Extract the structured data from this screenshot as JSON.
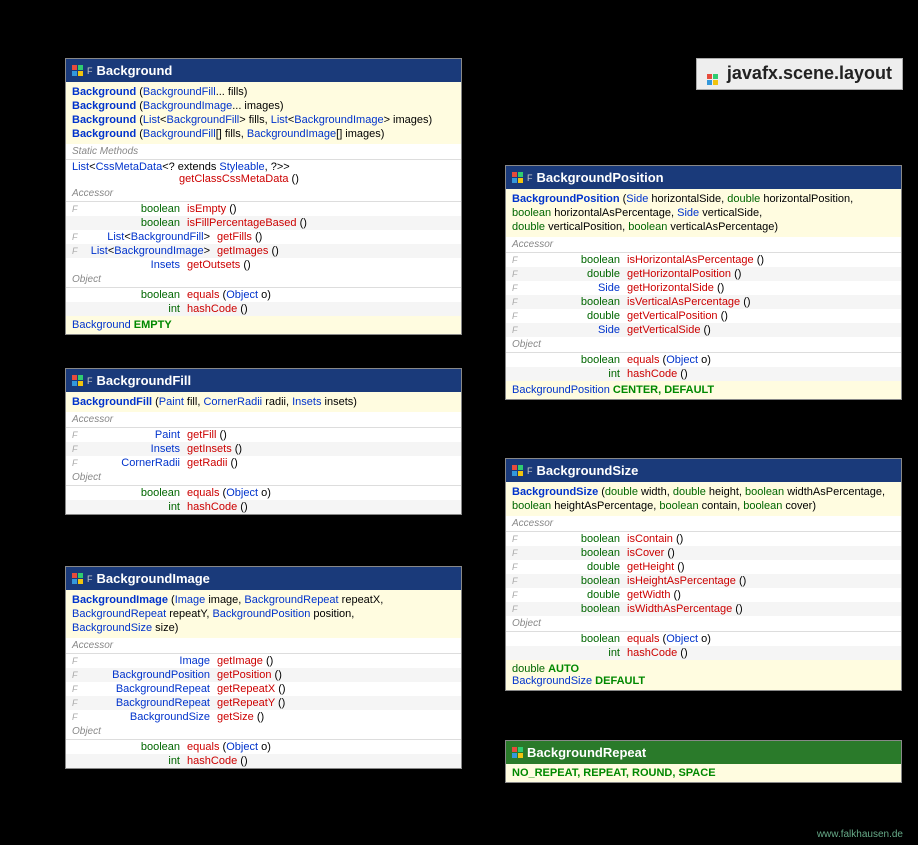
{
  "package": "javafx.scene.layout",
  "footer": "www.falkhausen.de",
  "classes": {
    "background": {
      "name": "Background",
      "final": true,
      "constructors": [
        [
          [
            "class",
            "Background"
          ],
          [
            " ("
          ],
          [
            "link",
            "BackgroundFill"
          ],
          [
            "",
            "... fills)"
          ]
        ],
        [
          [
            "class",
            "Background"
          ],
          [
            " ("
          ],
          [
            "link",
            "BackgroundImage"
          ],
          [
            "",
            "... images)"
          ]
        ],
        [
          [
            "class",
            "Background"
          ],
          [
            " ("
          ],
          [
            "link",
            "List"
          ],
          [
            "",
            "<"
          ],
          [
            "link",
            "BackgroundFill"
          ],
          [
            "",
            "> fills, "
          ],
          [
            "link",
            "List"
          ],
          [
            "",
            "<"
          ],
          [
            "link",
            "BackgroundImage"
          ],
          [
            "",
            "> images)"
          ]
        ],
        [
          [
            "class",
            "Background"
          ],
          [
            " ("
          ],
          [
            "link",
            "BackgroundFill"
          ],
          [
            "",
            "[] fills, "
          ],
          [
            "link",
            "BackgroundImage"
          ],
          [
            "",
            "[] images)"
          ]
        ]
      ],
      "static_label": "Static Methods",
      "static_methods": [
        {
          "ret": [
            [
              "link",
              "List"
            ],
            [
              "",
              "<"
            ],
            [
              "link",
              "CssMetaData"
            ],
            [
              "",
              "<? extends "
            ],
            [
              "link",
              "Styleable"
            ],
            [
              "",
              ", ?>>"
            ]
          ],
          "name": "getClassCssMetaData",
          "args": "()",
          "full": true
        }
      ],
      "accessor_label": "Accessor",
      "accessors": [
        {
          "f": true,
          "ret": [
            [
              "prim",
              "boolean"
            ]
          ],
          "name": "isEmpty",
          "args": "()"
        },
        {
          "f": false,
          "ret": [
            [
              "prim",
              "boolean"
            ]
          ],
          "name": "isFillPercentageBased",
          "args": "()"
        },
        {
          "f": true,
          "ret": [
            [
              "link",
              "List"
            ],
            [
              "",
              "<"
            ],
            [
              "link",
              "BackgroundFill"
            ],
            [
              "",
              ">"
            ]
          ],
          "name": "getFills",
          "args": "()",
          "wide": true
        },
        {
          "f": true,
          "ret": [
            [
              "link",
              "List"
            ],
            [
              "",
              "<"
            ],
            [
              "link",
              "BackgroundImage"
            ],
            [
              "",
              ">"
            ]
          ],
          "name": "getImages",
          "args": "()",
          "wide": true
        },
        {
          "f": false,
          "ret": [
            [
              "link",
              "Insets"
            ]
          ],
          "name": "getOutsets",
          "args": "()"
        }
      ],
      "object_label": "Object",
      "object_methods": [
        {
          "ret": [
            [
              "prim",
              "boolean"
            ]
          ],
          "name": "equals",
          "args": [
            [
              "",
              ""
            ],
            [
              "",
              " ("
            ],
            [
              "link",
              "Object"
            ],
            [
              "",
              " o)"
            ]
          ]
        },
        {
          "ret": [
            [
              "prim",
              "int"
            ]
          ],
          "name": "hashCode",
          "args": [
            [
              "",
              " ()"
            ]
          ]
        }
      ],
      "constants": [
        {
          "type": "Background",
          "vals": "EMPTY"
        }
      ]
    },
    "backgroundFill": {
      "name": "BackgroundFill",
      "final": true,
      "constructors": [
        [
          [
            "class",
            "BackgroundFill"
          ],
          [
            " ("
          ],
          [
            "link",
            "Paint"
          ],
          [
            "",
            " fill, "
          ],
          [
            "link",
            "CornerRadii"
          ],
          [
            "",
            " radii, "
          ],
          [
            "link",
            "Insets"
          ],
          [
            "",
            " insets)"
          ]
        ]
      ],
      "accessor_label": "Accessor",
      "accessors": [
        {
          "f": true,
          "ret": [
            [
              "link",
              "Paint"
            ]
          ],
          "name": "getFill",
          "args": "()"
        },
        {
          "f": true,
          "ret": [
            [
              "link",
              "Insets"
            ]
          ],
          "name": "getInsets",
          "args": "()"
        },
        {
          "f": true,
          "ret": [
            [
              "link",
              "CornerRadii"
            ]
          ],
          "name": "getRadii",
          "args": "()"
        }
      ],
      "object_label": "Object",
      "object_methods": [
        {
          "ret": [
            [
              "prim",
              "boolean"
            ]
          ],
          "name": "equals",
          "args": [
            [
              "",
              " ("
            ],
            [
              "link",
              "Object"
            ],
            [
              "",
              " o)"
            ]
          ]
        },
        {
          "ret": [
            [
              "prim",
              "int"
            ]
          ],
          "name": "hashCode",
          "args": [
            [
              "",
              " ()"
            ]
          ]
        }
      ]
    },
    "backgroundImage": {
      "name": "BackgroundImage",
      "final": true,
      "constructors": [
        [
          [
            "class",
            "BackgroundImage"
          ],
          [
            " ("
          ],
          [
            "link",
            "Image"
          ],
          [
            "",
            " image, "
          ],
          [
            "link",
            "BackgroundRepeat"
          ],
          [
            "",
            " repeatX,"
          ]
        ],
        [
          [
            "",
            "        "
          ],
          [
            "link",
            "BackgroundRepeat"
          ],
          [
            "",
            " repeatY, "
          ],
          [
            "link",
            "BackgroundPosition"
          ],
          [
            "",
            " position,"
          ]
        ],
        [
          [
            "",
            "        "
          ],
          [
            "link",
            "BackgroundSize"
          ],
          [
            "",
            " size)"
          ]
        ]
      ],
      "accessor_label": "Accessor",
      "accessors": [
        {
          "f": true,
          "ret": [
            [
              "link",
              "Image"
            ]
          ],
          "name": "getImage",
          "args": "()",
          "wide": true
        },
        {
          "f": true,
          "ret": [
            [
              "link",
              "BackgroundPosition"
            ]
          ],
          "name": "getPosition",
          "args": "()",
          "wide": true
        },
        {
          "f": true,
          "ret": [
            [
              "link",
              "BackgroundRepeat"
            ]
          ],
          "name": "getRepeatX",
          "args": "()",
          "wide": true
        },
        {
          "f": true,
          "ret": [
            [
              "link",
              "BackgroundRepeat"
            ]
          ],
          "name": "getRepeatY",
          "args": "()",
          "wide": true
        },
        {
          "f": true,
          "ret": [
            [
              "link",
              "BackgroundSize"
            ]
          ],
          "name": "getSize",
          "args": "()",
          "wide": true
        }
      ],
      "object_label": "Object",
      "object_methods": [
        {
          "ret": [
            [
              "prim",
              "boolean"
            ]
          ],
          "name": "equals",
          "args": [
            [
              "",
              " ("
            ],
            [
              "link",
              "Object"
            ],
            [
              "",
              " o)"
            ]
          ]
        },
        {
          "ret": [
            [
              "prim",
              "int"
            ]
          ],
          "name": "hashCode",
          "args": [
            [
              "",
              " ()"
            ]
          ]
        }
      ]
    },
    "backgroundPosition": {
      "name": "BackgroundPosition",
      "final": true,
      "constructors": [
        [
          [
            "class",
            "BackgroundPosition"
          ],
          [
            " ("
          ],
          [
            "link",
            "Side"
          ],
          [
            "",
            " horizontalSide, "
          ],
          [
            "prim",
            "double"
          ],
          [
            "",
            " horizontalPosition,"
          ]
        ],
        [
          [
            "",
            "        "
          ],
          [
            "prim",
            "boolean"
          ],
          [
            "",
            " horizontalAsPercentage, "
          ],
          [
            "link",
            "Side"
          ],
          [
            "",
            " verticalSide,"
          ]
        ],
        [
          [
            "",
            "        "
          ],
          [
            "prim",
            "double"
          ],
          [
            "",
            " verticalPosition, "
          ],
          [
            "prim",
            "boolean"
          ],
          [
            "",
            " verticalAsPercentage)"
          ]
        ]
      ],
      "accessor_label": "Accessor",
      "accessors": [
        {
          "f": true,
          "ret": [
            [
              "prim",
              "boolean"
            ]
          ],
          "name": "isHorizontalAsPercentage",
          "args": "()"
        },
        {
          "f": true,
          "ret": [
            [
              "prim",
              "double"
            ]
          ],
          "name": "getHorizontalPosition",
          "args": "()"
        },
        {
          "f": true,
          "ret": [
            [
              "link",
              "Side"
            ]
          ],
          "name": "getHorizontalSide",
          "args": "()"
        },
        {
          "f": true,
          "ret": [
            [
              "prim",
              "boolean"
            ]
          ],
          "name": "isVerticalAsPercentage",
          "args": "()"
        },
        {
          "f": true,
          "ret": [
            [
              "prim",
              "double"
            ]
          ],
          "name": "getVerticalPosition",
          "args": "()"
        },
        {
          "f": true,
          "ret": [
            [
              "link",
              "Side"
            ]
          ],
          "name": "getVerticalSide",
          "args": "()"
        }
      ],
      "object_label": "Object",
      "object_methods": [
        {
          "ret": [
            [
              "prim",
              "boolean"
            ]
          ],
          "name": "equals",
          "args": [
            [
              "",
              " ("
            ],
            [
              "link",
              "Object"
            ],
            [
              "",
              " o)"
            ]
          ]
        },
        {
          "ret": [
            [
              "prim",
              "int"
            ]
          ],
          "name": "hashCode",
          "args": [
            [
              "",
              " ()"
            ]
          ]
        }
      ],
      "constants": [
        {
          "type": "BackgroundPosition",
          "vals": "CENTER, DEFAULT"
        }
      ]
    },
    "backgroundSize": {
      "name": "BackgroundSize",
      "final": true,
      "constructors": [
        [
          [
            "class",
            "BackgroundSize"
          ],
          [
            " ("
          ],
          [
            "prim",
            "double"
          ],
          [
            "",
            " width, "
          ],
          [
            "prim",
            "double"
          ],
          [
            "",
            " height, "
          ],
          [
            "prim",
            "boolean"
          ],
          [
            "",
            " widthAsPercentage,"
          ]
        ],
        [
          [
            "",
            "        "
          ],
          [
            "prim",
            "boolean"
          ],
          [
            "",
            " heightAsPercentage, "
          ],
          [
            "prim",
            "boolean"
          ],
          [
            "",
            " contain, "
          ],
          [
            "prim",
            "boolean"
          ],
          [
            "",
            " cover)"
          ]
        ]
      ],
      "accessor_label": "Accessor",
      "accessors": [
        {
          "f": true,
          "ret": [
            [
              "prim",
              "boolean"
            ]
          ],
          "name": "isContain",
          "args": "()"
        },
        {
          "f": true,
          "ret": [
            [
              "prim",
              "boolean"
            ]
          ],
          "name": "isCover",
          "args": "()"
        },
        {
          "f": true,
          "ret": [
            [
              "prim",
              "double"
            ]
          ],
          "name": "getHeight",
          "args": "()"
        },
        {
          "f": true,
          "ret": [
            [
              "prim",
              "boolean"
            ]
          ],
          "name": "isHeightAsPercentage",
          "args": "()"
        },
        {
          "f": true,
          "ret": [
            [
              "prim",
              "double"
            ]
          ],
          "name": "getWidth",
          "args": "()"
        },
        {
          "f": true,
          "ret": [
            [
              "prim",
              "boolean"
            ]
          ],
          "name": "isWidthAsPercentage",
          "args": "()"
        }
      ],
      "object_label": "Object",
      "object_methods": [
        {
          "ret": [
            [
              "prim",
              "boolean"
            ]
          ],
          "name": "equals",
          "args": [
            [
              "",
              " ("
            ],
            [
              "link",
              "Object"
            ],
            [
              "",
              " o)"
            ]
          ]
        },
        {
          "ret": [
            [
              "prim",
              "int"
            ]
          ],
          "name": "hashCode",
          "args": [
            [
              "",
              " ()"
            ]
          ]
        }
      ],
      "constants": [
        {
          "type_tokens": [
            [
              "prim",
              "double"
            ]
          ],
          "vals": "AUTO"
        },
        {
          "type": "BackgroundSize",
          "vals": "DEFAULT"
        }
      ]
    },
    "backgroundRepeat": {
      "name": "BackgroundRepeat",
      "enum": true,
      "constants_line": "NO_REPEAT, REPEAT, ROUND, SPACE"
    }
  }
}
